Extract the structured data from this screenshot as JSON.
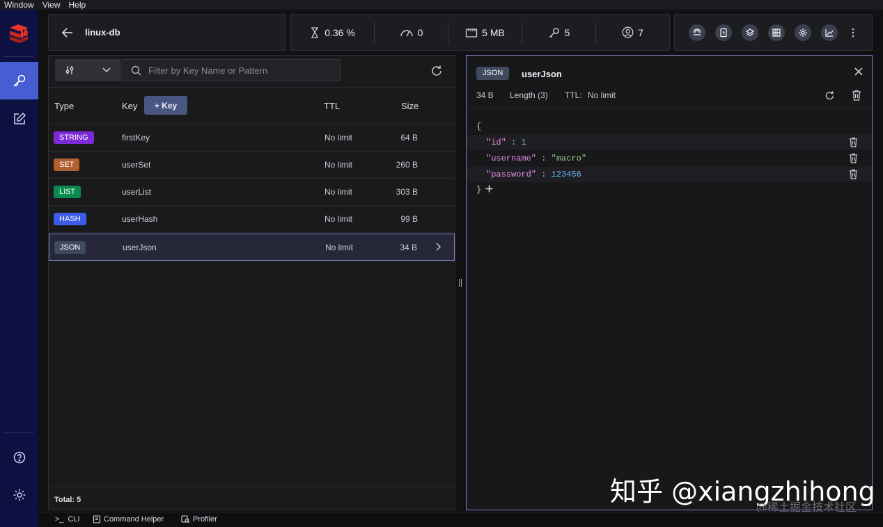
{
  "menu": [
    "Window",
    "View",
    "Help"
  ],
  "header": {
    "db_name": "linux-db",
    "stats": {
      "cpu": "0.36 %",
      "ops": "0",
      "memory": "5 MB",
      "keys": "5",
      "clients": "7"
    }
  },
  "browser": {
    "search_placeholder": "Filter by Key Name or Pattern",
    "columns": {
      "type": "Type",
      "key": "Key",
      "ttl": "TTL",
      "size": "Size"
    },
    "add_key_label": "+ Key",
    "rows": [
      {
        "type": "STRING",
        "color": "#7b2ad6",
        "key": "firstKey",
        "ttl": "No limit",
        "size": "64 B"
      },
      {
        "type": "SET",
        "color": "#b35f2d",
        "key": "userSet",
        "ttl": "No limit",
        "size": "260 B"
      },
      {
        "type": "LIST",
        "color": "#0b8a4f",
        "key": "userList",
        "ttl": "No limit",
        "size": "303 B"
      },
      {
        "type": "HASH",
        "color": "#3c5be6",
        "key": "userHash",
        "ttl": "No limit",
        "size": "99 B"
      },
      {
        "type": "JSON",
        "color": "#3f4a5f",
        "key": "userJson",
        "ttl": "No limit",
        "size": "34 B"
      }
    ],
    "total": "Total: 5"
  },
  "detail": {
    "type": "JSON",
    "key": "userJson",
    "size": "34 B",
    "length": "Length (3)",
    "ttl_label": "TTL:",
    "ttl_value": "No limit",
    "open_brace": "{",
    "close_brace": "}",
    "fields": [
      {
        "key": "\"id\"",
        "colon": ":",
        "value": "1",
        "kind": "num"
      },
      {
        "key": "\"username\"",
        "colon": ":",
        "value": "\"macro\"",
        "kind": "str"
      },
      {
        "key": "\"password\"",
        "colon": ":",
        "value": "123456",
        "kind": "num"
      }
    ]
  },
  "bottom": {
    "cli": "CLI",
    "cli_prefix": ">_",
    "command_helper": "Command Helper",
    "profiler": "Profiler"
  },
  "watermark": {
    "main": "知乎 @xiangzhihong",
    "sub": "@稀土掘金技术社区"
  }
}
